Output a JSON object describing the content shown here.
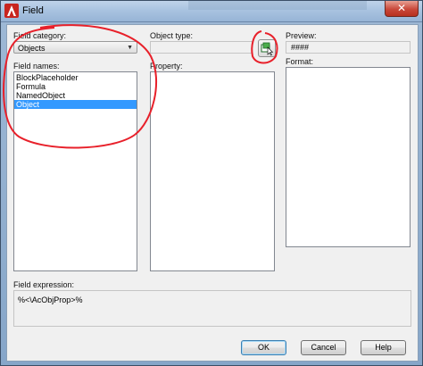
{
  "window": {
    "title": "Field",
    "close_glyph": "✕"
  },
  "field_category": {
    "label": "Field category:",
    "value": "Objects"
  },
  "field_names": {
    "label": "Field names:",
    "items": [
      "BlockPlaceholder",
      "Formula",
      "NamedObject",
      "Object"
    ],
    "selected": "Object"
  },
  "object_type": {
    "label": "Object type:",
    "select_button_icon": "select-object-icon"
  },
  "property": {
    "label": "Property:"
  },
  "preview": {
    "label": "Preview:",
    "value": "####"
  },
  "format": {
    "label": "Format:"
  },
  "field_expression": {
    "label": "Field expression:",
    "value": "%<\\AcObjProp>%"
  },
  "buttons": {
    "ok": "OK",
    "cancel": "Cancel",
    "help": "Help"
  },
  "colors": {
    "selection": "#3399ff",
    "annotation": "#e8202a"
  }
}
